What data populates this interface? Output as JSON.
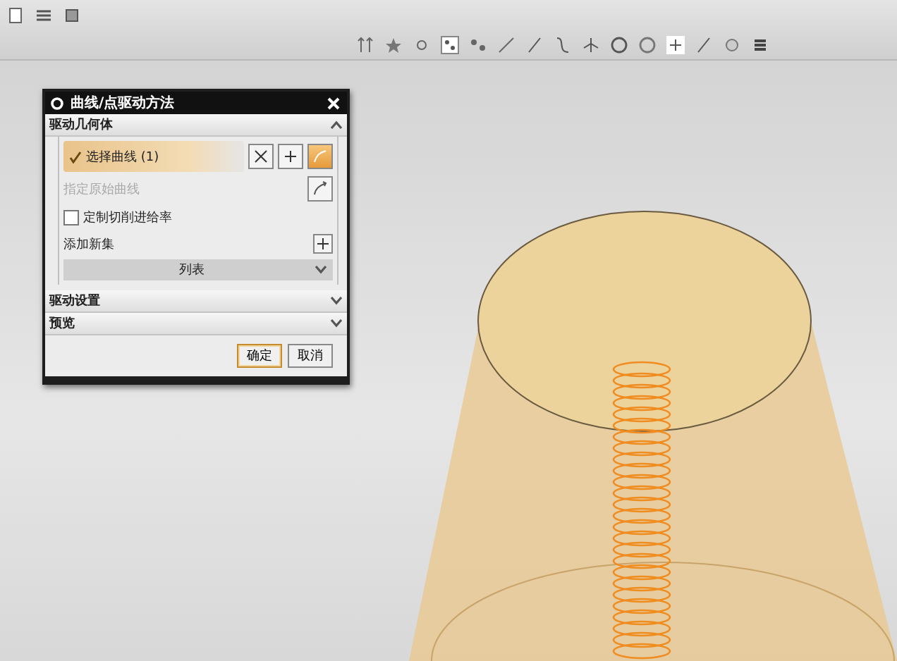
{
  "dialog": {
    "title": "曲线/点驱动方法",
    "sections": [
      {
        "title": "驱动几何体",
        "expanded": true
      },
      {
        "title": "驱动设置",
        "expanded": false
      },
      {
        "title": "预览",
        "expanded": false
      }
    ],
    "select_curve": {
      "label": "选择曲线 (1)",
      "selected": true
    },
    "origin_curve": {
      "label": "指定原始曲线",
      "disabled": true
    },
    "custom_feed": {
      "label": "定制切削进给率",
      "checked": false
    },
    "add_set": {
      "label": "添加新集"
    },
    "list": {
      "label": "列表",
      "expanded": false
    },
    "buttons": [
      {
        "label": "确定",
        "default": true
      },
      {
        "label": "取消",
        "default": false
      }
    ]
  }
}
